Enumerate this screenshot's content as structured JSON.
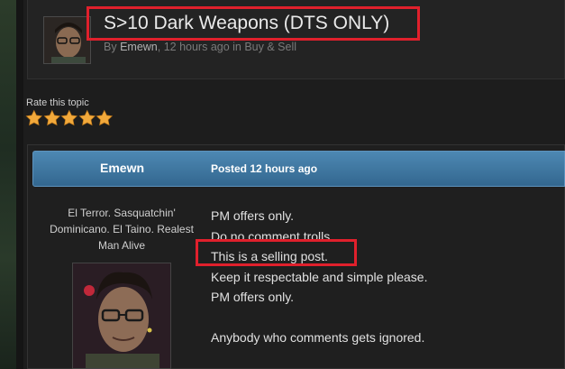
{
  "topic": {
    "title": "S>10 Dark Weapons (DTS ONLY)",
    "meta_prefix": "By ",
    "author": "Emewn",
    "meta_suffix": ", 12 hours ago in Buy & Sell"
  },
  "rating": {
    "label": "Rate this topic",
    "stars": 5,
    "star_color": "#f2a93b"
  },
  "post": {
    "author": "Emewn",
    "posted": "Posted 12 hours ago",
    "user_title_lines": [
      "El Terror. Sasquatchin'",
      "Dominicano. El Taino. Realest",
      "Man Alive"
    ],
    "body": [
      "PM offers only.",
      "Do no comment trolls.",
      "This is a selling post.",
      "Keep it respectable and simple please.",
      "PM offers only.",
      "",
      "Anybody who comments gets ignored."
    ]
  },
  "colors": {
    "accent_bar": "#3f7aa6",
    "highlight": "#e0202c"
  }
}
